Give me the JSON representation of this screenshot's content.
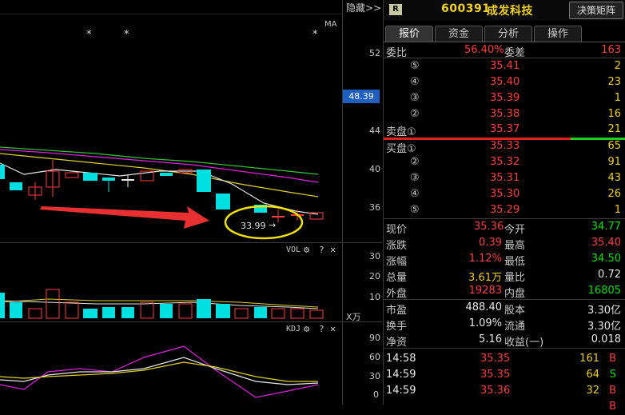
{
  "chart": {
    "hide_label": "隐藏>>",
    "ma_label": "MA",
    "price_ticks": [
      "52",
      "48",
      "44",
      "40",
      "36"
    ],
    "current_price_tag": "48.39",
    "annotation_price": "33.99",
    "vol_label": "VOL",
    "vol_ticks": [
      "30",
      "20",
      "10"
    ],
    "vol_unit": "X万",
    "kdj_label": "KDJ",
    "kdj_ticks": [
      "90",
      "60",
      "30",
      "0"
    ],
    "help_glyph": "?",
    "close_glyph": "✕",
    "settings_glyph": "⚙",
    "star_glyph": "*"
  },
  "header": {
    "badge": "R",
    "code": "600391",
    "name": "成发科技",
    "decision_button": "决策矩阵"
  },
  "tabs": [
    {
      "label": "报价"
    },
    {
      "label": "资金"
    },
    {
      "label": "分析"
    },
    {
      "label": "操作"
    }
  ],
  "ratio": {
    "label": "委比",
    "value": "56.40%",
    "diff_label": "委差",
    "diff_value": "163"
  },
  "asks": [
    {
      "label": "⑤",
      "price": "35.41",
      "volume": "2"
    },
    {
      "label": "④",
      "price": "35.40",
      "volume": "23"
    },
    {
      "label": "③",
      "price": "35.39",
      "volume": "1"
    },
    {
      "label": "②",
      "price": "35.38",
      "volume": "16"
    },
    {
      "label": "卖盘①",
      "price": "35.37",
      "volume": "21"
    }
  ],
  "bids": [
    {
      "label": "买盘①",
      "price": "35.33",
      "volume": "65"
    },
    {
      "label": "②",
      "price": "35.32",
      "volume": "91"
    },
    {
      "label": "③",
      "price": "35.31",
      "volume": "43"
    },
    {
      "label": "④",
      "price": "35.30",
      "volume": "26"
    },
    {
      "label": "⑤",
      "price": "35.29",
      "volume": "1"
    }
  ],
  "stats": [
    {
      "l1": "现价",
      "v1": "35.36",
      "c1": "red",
      "l2": "今开",
      "v2": "34.77",
      "c2": "green"
    },
    {
      "l1": "涨跌",
      "v1": "0.39",
      "c1": "red",
      "l2": "最高",
      "v2": "35.40",
      "c2": "red"
    },
    {
      "l1": "涨幅",
      "v1": "1.12%",
      "c1": "red",
      "l2": "最低",
      "v2": "34.50",
      "c2": "green"
    },
    {
      "l1": "总量",
      "v1": "3.61万",
      "c1": "yellow",
      "l2": "量比",
      "v2": "0.72",
      "c2": "white"
    },
    {
      "l1": "外盘",
      "v1": "19283",
      "c1": "red",
      "l2": "内盘",
      "v2": "16805",
      "c2": "green"
    }
  ],
  "fundamentals": [
    {
      "l1": "市盈",
      "v1": "488.40",
      "l2": "股本",
      "v2": "3.30亿"
    },
    {
      "l1": "换手",
      "v1": "1.09%",
      "l2": "流通",
      "v2": "3.30亿"
    },
    {
      "l1": "净资",
      "v1": "5.16",
      "l2": "收益(一)",
      "v2": "0.018"
    }
  ],
  "trades": [
    {
      "time": "14:58",
      "price": "35.35",
      "volume": "161",
      "side": "B"
    },
    {
      "time": "14:59",
      "price": "35.35",
      "volume": "64",
      "side": "S"
    },
    {
      "time": "14:59",
      "price": "35.36",
      "volume": "32",
      "side": "B"
    },
    {
      "time": "",
      "price": "",
      "volume": "",
      "side": "B"
    }
  ],
  "colors": {
    "up": "#ff3c3c",
    "down": "#00e0e0",
    "accent": "#f0d020",
    "price_tag": "#1f5fbf"
  }
}
